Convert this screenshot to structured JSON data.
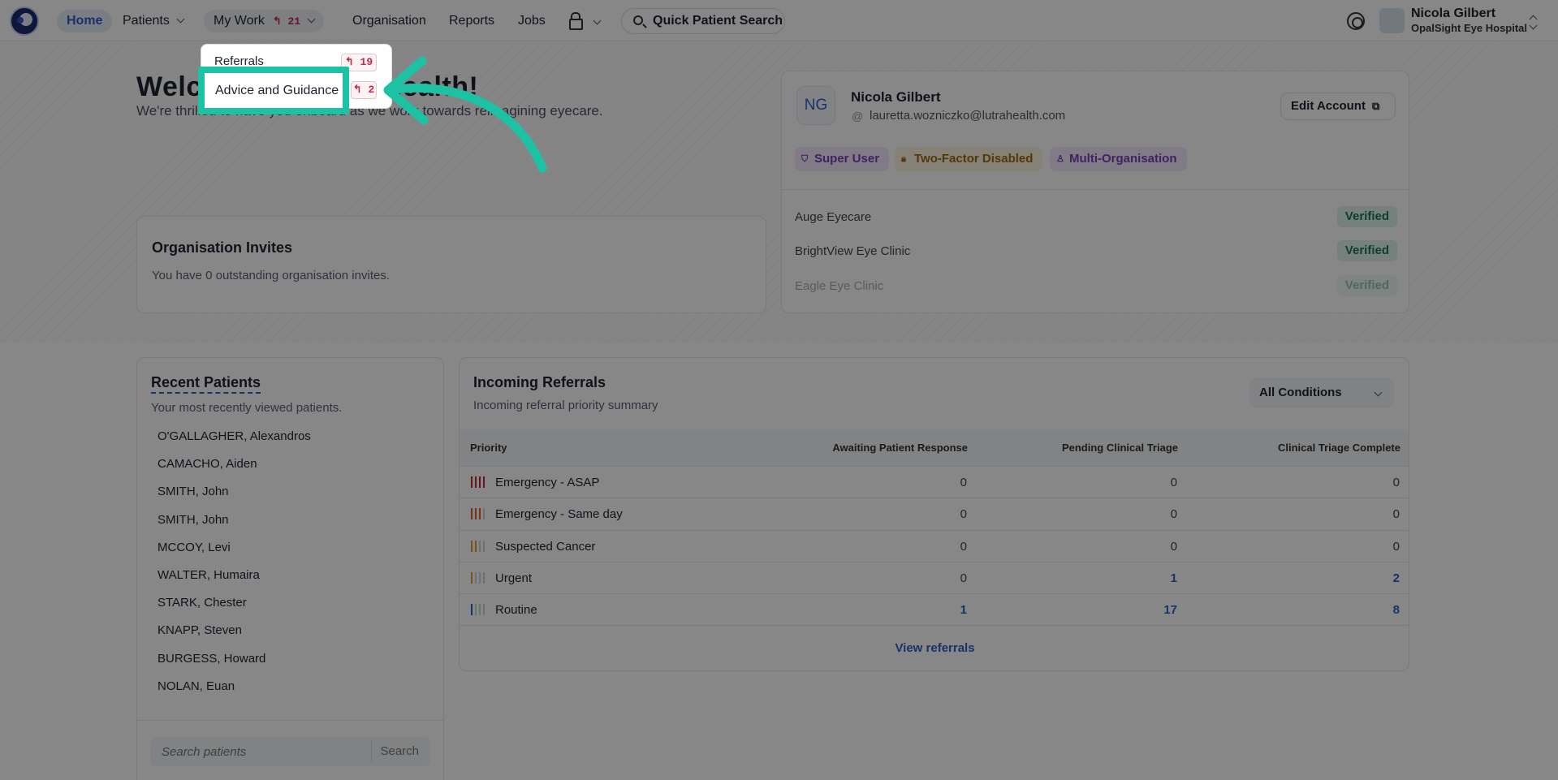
{
  "nav": {
    "home": "Home",
    "patients": "Patients",
    "my_work": "My Work",
    "my_work_count": "↰ 21",
    "organisation": "Organisation",
    "reports": "Reports",
    "jobs": "Jobs",
    "quick_search": "Quick Patient Search",
    "user_name": "Nicola Gilbert",
    "user_org": "OpalSight Eye Hospital"
  },
  "my_work_menu": {
    "items": [
      {
        "label": "Referrals",
        "count": "↰ 19"
      },
      {
        "label": "Advice and Guidance",
        "count": "↰ 2"
      }
    ]
  },
  "hero": {
    "welcome": "Welcome to Lutra Health!",
    "subtitle": "We're thrilled to have you onboard as we work towards reimagining eyecare."
  },
  "invites": {
    "title": "Organisation Invites",
    "text": "You have 0 outstanding organisation invites."
  },
  "account": {
    "initials": "NG",
    "name": "Nicola Gilbert",
    "email": "lauretta.wozniczko@lutrahealth.com",
    "edit_label": "Edit Account",
    "badges": [
      "Super User",
      "Two-Factor Disabled",
      "Multi-Organisation"
    ],
    "orgs": [
      {
        "name": "Auge Eyecare",
        "status": "Verified"
      },
      {
        "name": "BrightView Eye Clinic",
        "status": "Verified"
      },
      {
        "name": "Eagle Eye Clinic",
        "status": "Verified"
      }
    ],
    "badge_colors": {
      "super_user": "#7a3fb8",
      "two_factor": "#9a6a12",
      "multi_org": "#7a3fb8"
    }
  },
  "recent": {
    "title": "Recent Patients",
    "subtitle": "Your most recently viewed patients.",
    "patients": [
      "O'GALLAGHER, Alexandros",
      "CAMACHO, Aiden",
      "SMITH, John",
      "SMITH, John",
      "MCCOY, Levi",
      "WALTER, Humaira",
      "STARK, Chester",
      "KNAPP, Steven",
      "BURGESS, Howard",
      "NOLAN, Euan"
    ],
    "search_placeholder": "Search patients",
    "search_button": "Search"
  },
  "referrals": {
    "title": "Incoming Referrals",
    "subtitle": "Incoming referral priority summary",
    "filter": "All Conditions",
    "columns": [
      "Priority",
      "Awaiting Patient Response",
      "Pending Clinical Triage",
      "Clinical Triage Complete"
    ],
    "rows": [
      {
        "priority": "Emergency - ASAP",
        "awaiting": "0",
        "pending": "0",
        "complete": "0",
        "color": "#c0253f",
        "level": 4
      },
      {
        "priority": "Emergency - Same day",
        "awaiting": "0",
        "pending": "0",
        "complete": "0",
        "color": "#e0612f",
        "level": 3
      },
      {
        "priority": "Suspected Cancer",
        "awaiting": "0",
        "pending": "0",
        "complete": "0",
        "color": "#d9a020",
        "level": 2
      },
      {
        "priority": "Urgent",
        "awaiting": "0",
        "pending": "1",
        "complete": "2",
        "color": "#d9a020",
        "level": 1
      },
      {
        "priority": "Routine",
        "awaiting": "1",
        "pending": "17",
        "complete": "8",
        "color": "#2f5fc6",
        "level": 1
      }
    ],
    "link": "View referrals"
  }
}
